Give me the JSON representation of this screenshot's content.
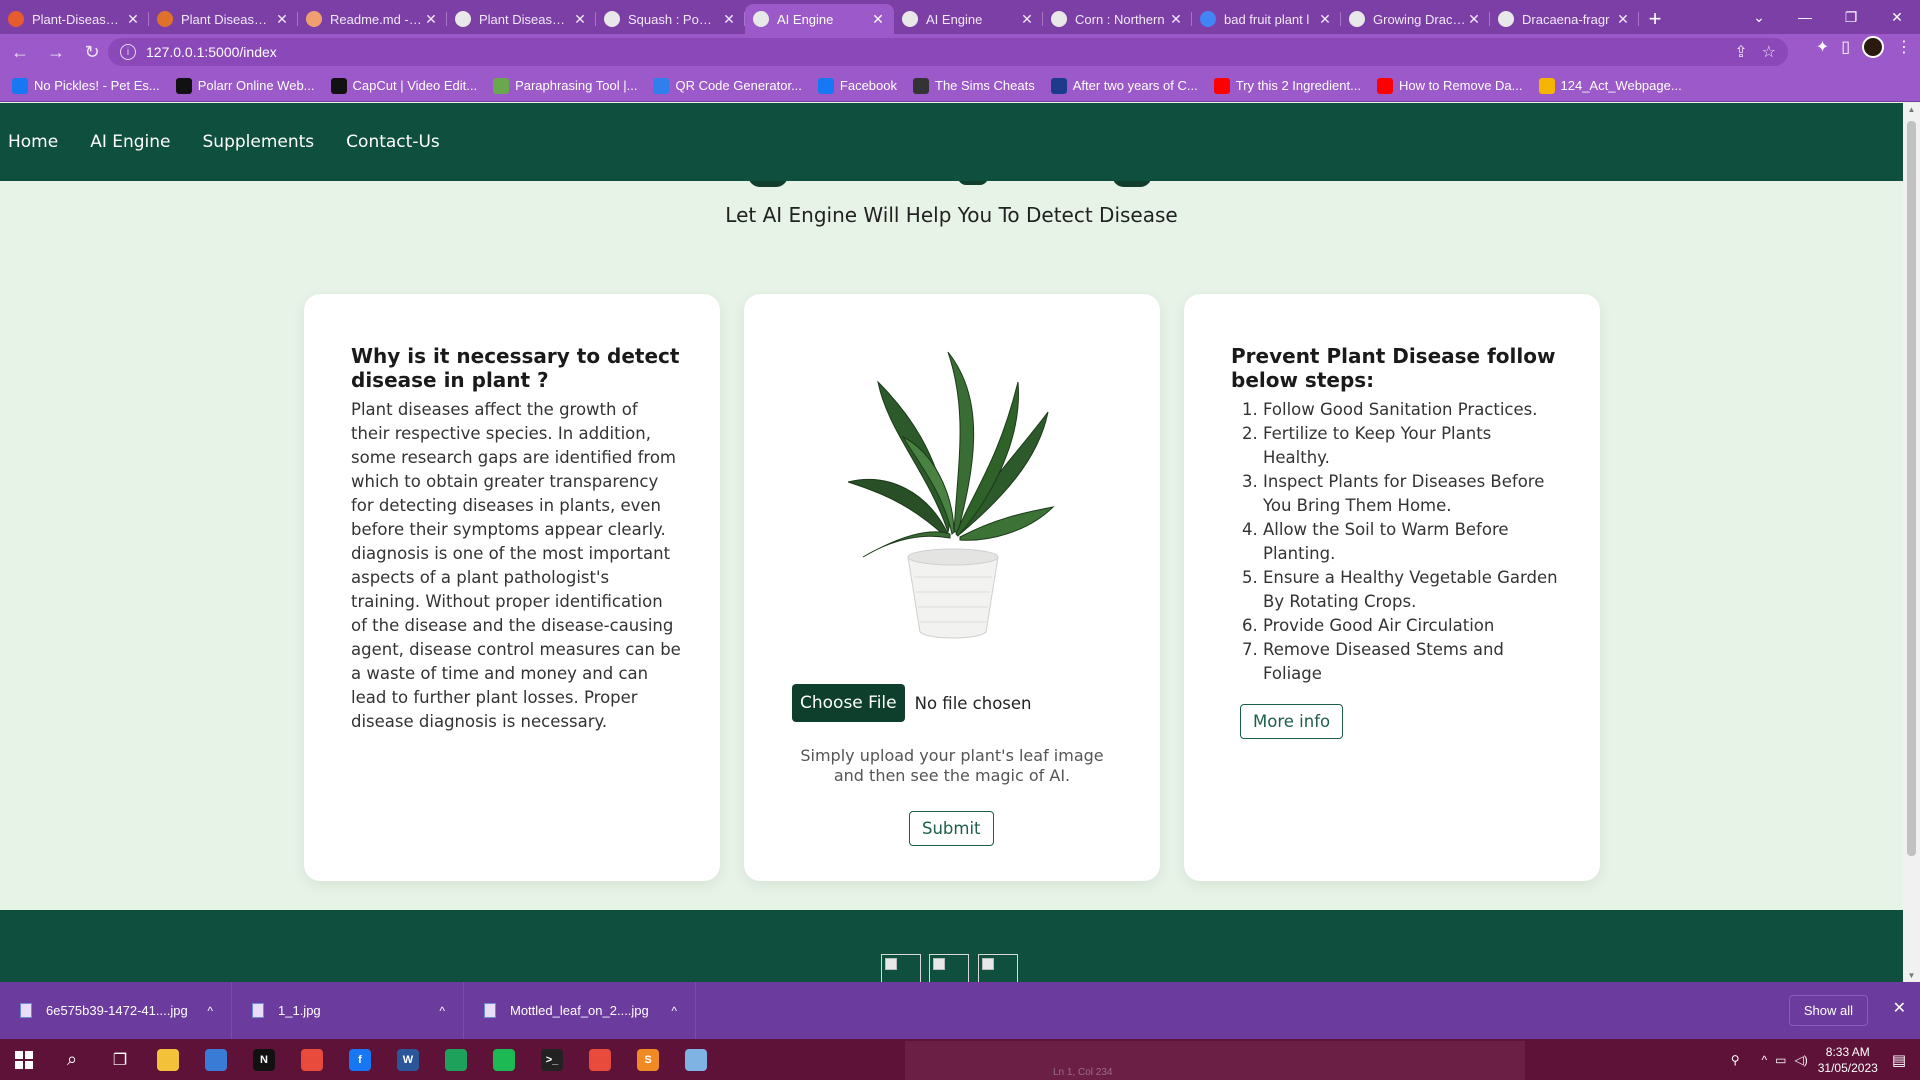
{
  "browser": {
    "tabs": [
      {
        "title": "Plant-Disease-D",
        "color": "#e55c2f"
      },
      {
        "title": "Plant Disease Dr",
        "color": "#e0712a"
      },
      {
        "title": "Readme.md - Ju",
        "color": "#f0a070"
      },
      {
        "title": "Plant Disease D",
        "color": "#e8e8e8"
      },
      {
        "title": "Squash : Powde",
        "color": "#e8e8e8"
      },
      {
        "title": "AI Engine",
        "color": "#e8e8e8"
      },
      {
        "title": "AI Engine",
        "color": "#e8e8e8"
      },
      {
        "title": "Corn : Northern",
        "color": "#e8e8e8"
      },
      {
        "title": "bad fruit plant l",
        "color": "#4285f4"
      },
      {
        "title": "Growing Dracae",
        "color": "#e8e8e8"
      },
      {
        "title": "Dracaena-fragr",
        "color": "#e8e8e8"
      }
    ],
    "active_tab_index": 5,
    "url": "127.0.0.1:5000/index",
    "bookmarks": [
      {
        "label": "No Pickles! - Pet Es...",
        "color": "#1877f2"
      },
      {
        "label": "Polarr Online Web...",
        "color": "#111111"
      },
      {
        "label": "CapCut | Video Edit...",
        "color": "#111111"
      },
      {
        "label": "Paraphrasing Tool |...",
        "color": "#6aa84f"
      },
      {
        "label": "QR Code Generator...",
        "color": "#2f80ed"
      },
      {
        "label": "Facebook",
        "color": "#1877f2"
      },
      {
        "label": "The Sims Cheats",
        "color": "#333333"
      },
      {
        "label": "After two years of C...",
        "color": "#1d3b8b"
      },
      {
        "label": "Try this 2 Ingredient...",
        "color": "#ff0000"
      },
      {
        "label": "How to Remove Da...",
        "color": "#ff0000"
      },
      {
        "label": "124_Act_Webpage...",
        "color": "#f4b400"
      }
    ]
  },
  "site": {
    "nav": [
      "Home",
      "AI Engine",
      "Supplements",
      "Contact-Us"
    ],
    "subtitle": "Let AI Engine Will Help You To Detect Disease",
    "left_card": {
      "heading": "Why is it necessary to detect disease in plant ?",
      "body": "Plant diseases affect the growth of their respective species. In addition, some research gaps are identified from which to obtain greater transparency for detecting diseases in plants, even before their symptoms appear clearly. diagnosis is one of the most important aspects of a plant pathologist's training. Without proper identification of the disease and the disease-causing agent, disease control measures can be a waste of time and money and can lead to further plant losses. Proper disease diagnosis is necessary."
    },
    "center_card": {
      "choose_file": "Choose File",
      "no_file": "No file chosen",
      "hint": "Simply upload your plant's leaf image and then see the magic of AI.",
      "submit": "Submit"
    },
    "right_card": {
      "heading": "Prevent Plant Disease follow below steps:",
      "steps": [
        "Follow Good Sanitation Practices.",
        "Fertilize to Keep Your Plants Healthy.",
        "Inspect Plants for Diseases Before You Bring Them Home.",
        "Allow the Soil to Warm Before Planting.",
        "Ensure a Healthy Vegetable Garden By Rotating Crops.",
        "Provide Good Air Circulation",
        "Remove Diseased Stems and Foliage"
      ],
      "more_info": "More info"
    },
    "colors": {
      "nav_bg": "#0f4f3d",
      "page_bg": "#e7f3e6",
      "accent": "#1d5e49"
    }
  },
  "downloads": {
    "files": [
      "6e575b39-1472-41....jpg",
      "1_1.jpg",
      "Mottled_leaf_on_2....jpg"
    ],
    "show_all": "Show all"
  },
  "taskbar": {
    "apps": [
      {
        "name": "file-explorer",
        "color": "#f3c13a",
        "glyph": ""
      },
      {
        "name": "store",
        "color": "#3a7bd5",
        "glyph": ""
      },
      {
        "name": "netflix",
        "color": "#111111",
        "glyph": "N"
      },
      {
        "name": "chrome",
        "color": "#e84a3c",
        "glyph": ""
      },
      {
        "name": "facebook",
        "color": "#1877f2",
        "glyph": "f"
      },
      {
        "name": "word",
        "color": "#2b579a",
        "glyph": "W"
      },
      {
        "name": "edge",
        "color": "#1ea15a",
        "glyph": ""
      },
      {
        "name": "spotify",
        "color": "#1db954",
        "glyph": ""
      },
      {
        "name": "terminal",
        "color": "#222222",
        "glyph": ">_"
      },
      {
        "name": "chrome-active",
        "color": "#e84a3c",
        "glyph": ""
      },
      {
        "name": "sublime",
        "color": "#f08a24",
        "glyph": "S"
      },
      {
        "name": "notepad",
        "color": "#7fb3e3",
        "glyph": ""
      }
    ],
    "time": "8:33 AM",
    "date": "31/05/2023",
    "editor_status": "Ln 1, Col 234"
  }
}
